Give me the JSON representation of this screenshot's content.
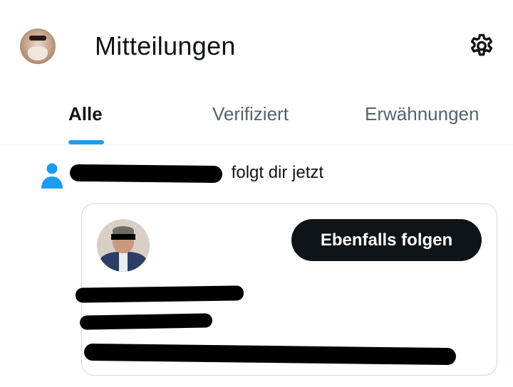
{
  "header": {
    "title": "Mitteilungen",
    "avatar_icon": "profile-avatar",
    "settings_icon": "gear-icon"
  },
  "tabs": [
    {
      "label": "Alle",
      "active": true
    },
    {
      "label": "Verifiziert",
      "active": false
    },
    {
      "label": "Erwähnungen",
      "active": false
    }
  ],
  "notification": {
    "icon": "person-icon",
    "name": "",
    "action_text": "folgt dir jetzt"
  },
  "card": {
    "follow_button_label": "Ebenfalls folgen",
    "name": "",
    "handle": "",
    "bio": ""
  },
  "colors": {
    "accent": "#1d9bf0",
    "text_primary": "#0f1419",
    "text_secondary": "#536471",
    "button_bg": "#0f1419",
    "border": "#cfd9de",
    "redaction": "#000000"
  }
}
